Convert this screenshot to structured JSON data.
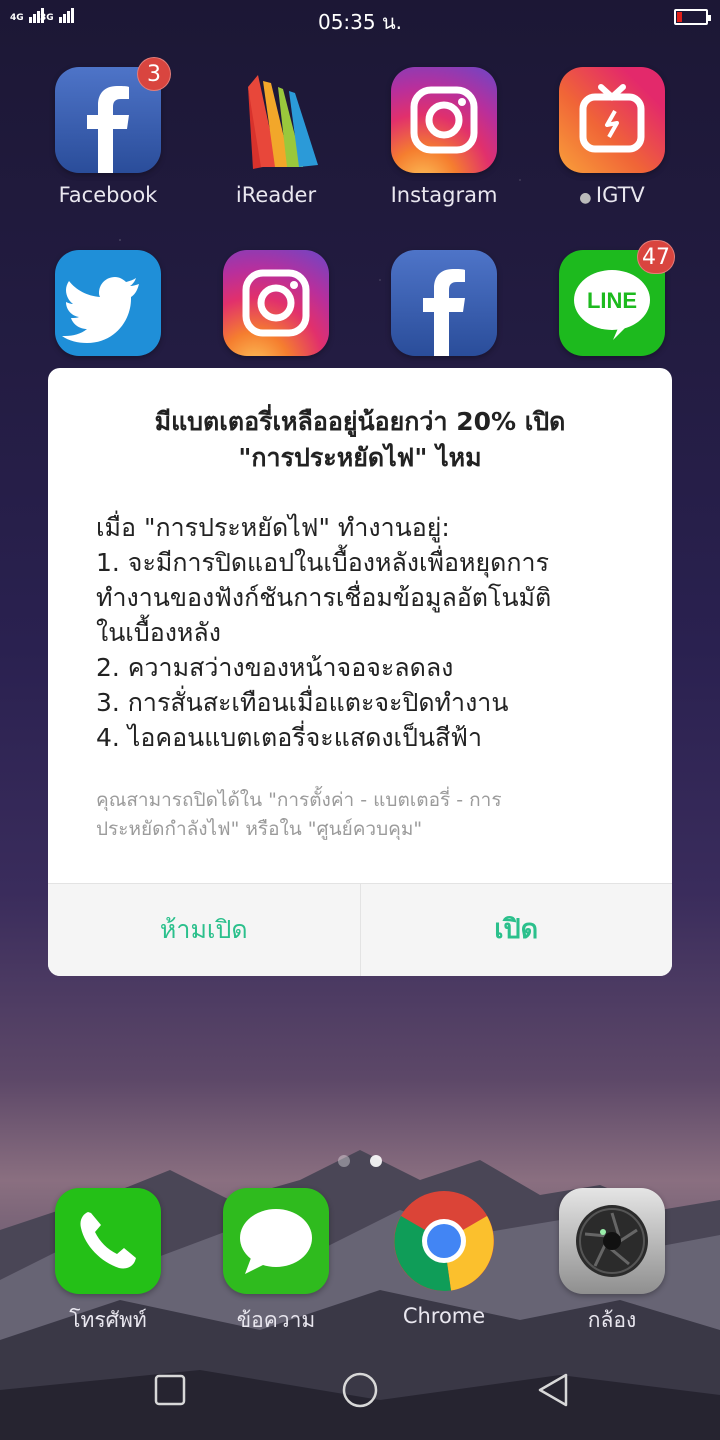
{
  "status": {
    "signal1": "4G",
    "signal2": "3G",
    "time": "05:35 น."
  },
  "apps_row1": [
    {
      "label": "Facebook",
      "icon": "facebook-icon",
      "badge": "3"
    },
    {
      "label": "iReader",
      "icon": "ireader-icon"
    },
    {
      "label": "Instagram",
      "icon": "instagram-icon"
    },
    {
      "label": "IGTV",
      "icon": "igtv-icon"
    }
  ],
  "apps_row2": [
    {
      "icon": "twitter-icon"
    },
    {
      "icon": "instagram-icon"
    },
    {
      "icon": "facebook-icon"
    },
    {
      "icon": "line-icon",
      "badge": "47",
      "text": "LINE"
    }
  ],
  "dock": [
    {
      "label": "โทรศัพท์",
      "icon": "phone-icon"
    },
    {
      "label": "ข้อความ",
      "icon": "messages-icon"
    },
    {
      "label": "Chrome",
      "icon": "chrome-icon"
    },
    {
      "label": "กล้อง",
      "icon": "camera-icon"
    }
  ],
  "dialog": {
    "title_line1": "มีแบตเตอรี่เหลืออยู่น้อยกว่า 20% เปิด",
    "title_line2": "\"การประหยัดไฟ\" ไหม",
    "body": [
      "เมื่อ \"การประหยัดไฟ\" ทำงานอยู่:",
      "1. จะมีการปิดแอปในเบื้องหลังเพื่อหยุดการ",
      "ทำงานของฟังก์ชันการเชื่อมข้อมูลอัตโนมัติ",
      "ในเบื้องหลัง",
      "2. ความสว่างของหน้าจอจะลดลง",
      "3. การสั่นสะเทือนเมื่อแตะจะปิดทำงาน",
      "4. ไอคอนแบตเตอรี่จะแสดงเป็นสีฟ้า"
    ],
    "note_line1": "คุณสามารถปิดได้ใน \"การตั้งค่า - แบตเตอรี่ - การ",
    "note_line2": "ประหยัดกำลังไฟ\" หรือใน \"ศูนย์ควบคุม\"",
    "cancel_label": "ห้ามเปิด",
    "confirm_label": "เปิด"
  },
  "colors": {
    "accent": "#2bc08c",
    "battery_low": "#e0201a",
    "badge": "#d9453f"
  }
}
